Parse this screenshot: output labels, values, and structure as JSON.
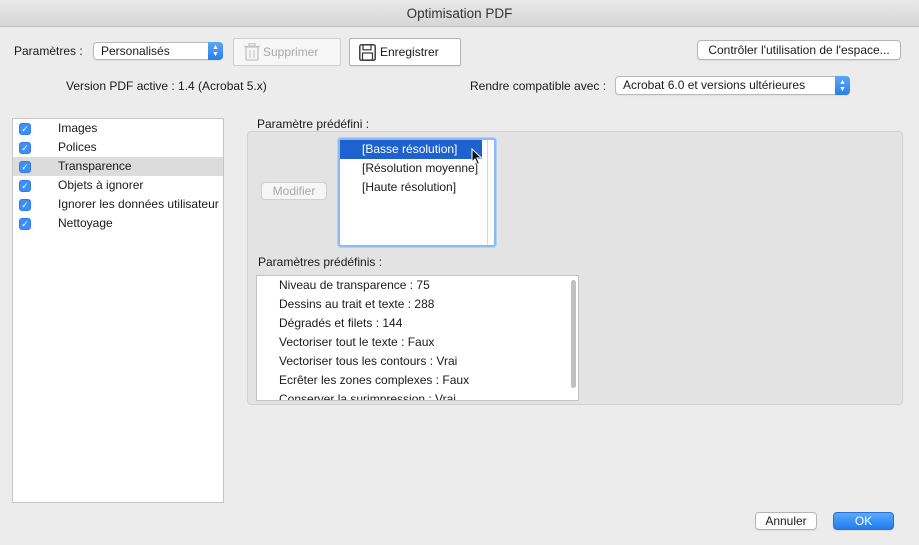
{
  "window": {
    "title": "Optimisation PDF"
  },
  "toolbar": {
    "params_label": "Paramètres :",
    "params_value": "Personalisés",
    "delete_label": "Supprimer",
    "save_label": "Enregistrer",
    "check_space_label": "Contrôler l'utilisation de l'espace..."
  },
  "version": {
    "active_label": "Version PDF active : 1.4 (Acrobat 5.x)",
    "compat_label": "Rendre compatible avec :",
    "compat_value": "Acrobat 6.0 et versions ultérieures"
  },
  "sidebar": {
    "items": [
      {
        "label": "Images",
        "checked": true
      },
      {
        "label": "Polices",
        "checked": true
      },
      {
        "label": "Transparence",
        "checked": true,
        "selected": true
      },
      {
        "label": "Objets à ignorer",
        "checked": true
      },
      {
        "label": "Ignorer les données utilisateur",
        "checked": true
      },
      {
        "label": "Nettoyage",
        "checked": true
      }
    ]
  },
  "transparency": {
    "preset_label": "Paramètre prédéfini :",
    "modify_label": "Modifier",
    "presets": [
      "[Basse résolution]",
      "[Résolution moyenne]",
      "[Haute résolution]"
    ],
    "selected_preset": "[Basse résolution]",
    "settings_label": "Paramètres prédéfinis :",
    "settings": [
      "Niveau de transparence : 75",
      "Dessins au trait et texte : 288",
      "Dégradés et filets : 144",
      "Vectoriser tout le texte : Faux",
      "Vectoriser tous les contours : Vrai",
      "Ecrêter les zones complexes : Faux",
      "Conserver la surimpression : Vrai"
    ]
  },
  "footer": {
    "cancel_label": "Annuler",
    "ok_label": "OK"
  },
  "colors": {
    "accent": "#1f7cf0",
    "selection": "#1e62d0"
  }
}
